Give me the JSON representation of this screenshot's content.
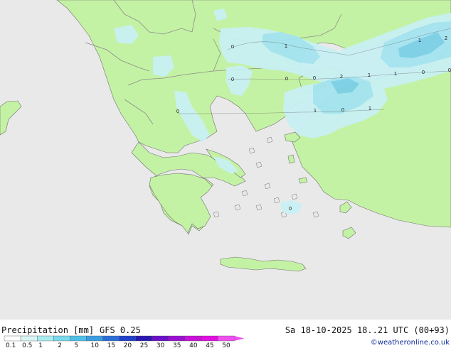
{
  "title": "Precipitation [mm]",
  "model": "GFS 0.25",
  "valid_time": "Sa 18-10-2025 18..21 UTC (00+93)",
  "credit": "©weatheronline.co.uk",
  "scale": {
    "labels": [
      "0.1",
      "0.5",
      "1",
      "2",
      "5",
      "10",
      "15",
      "20",
      "25",
      "30",
      "35",
      "40",
      "45",
      "50"
    ],
    "colors": [
      "#ffffff",
      "#d8f4f4",
      "#a8ecf0",
      "#7ad8ea",
      "#4ec0e8",
      "#3a9ee0",
      "#2c6ed8",
      "#2040c8",
      "#2a18b0",
      "#6a10c8",
      "#9a10d0",
      "#c810d8",
      "#e010e0",
      "#f050f0"
    ]
  },
  "colors": {
    "sea": "#e9e9e9",
    "land": "#c4f2a4",
    "border": "#8c8c8c",
    "coast": "#707070",
    "precip_light": "#c8f0f4",
    "precip_mid": "#a4e4f0",
    "precip_heavy": "#7cd0e6"
  },
  "contour_labels": [
    {
      "text": "0",
      "lon": 327,
      "lat": 68
    },
    {
      "text": "1",
      "lon": 402,
      "lat": 67
    },
    {
      "text": "1",
      "lon": 590,
      "lat": 59
    },
    {
      "text": "2",
      "lon": 627,
      "lat": 56
    },
    {
      "text": "0",
      "lon": 327,
      "lat": 114
    },
    {
      "text": "0",
      "lon": 403,
      "lat": 113
    },
    {
      "text": "0",
      "lon": 442,
      "lat": 112
    },
    {
      "text": "2",
      "lon": 480,
      "lat": 110
    },
    {
      "text": "1",
      "lon": 519,
      "lat": 108
    },
    {
      "text": "1",
      "lon": 556,
      "lat": 106
    },
    {
      "text": "0",
      "lon": 595,
      "lat": 104
    },
    {
      "text": "0",
      "lon": 632,
      "lat": 101
    },
    {
      "text": "0",
      "lon": 250,
      "lat": 159
    },
    {
      "text": "1",
      "lon": 443,
      "lat": 158
    },
    {
      "text": "0",
      "lon": 482,
      "lat": 157
    },
    {
      "text": "1",
      "lon": 520,
      "lat": 155
    },
    {
      "text": "0",
      "lon": 408,
      "lat": 296
    }
  ]
}
